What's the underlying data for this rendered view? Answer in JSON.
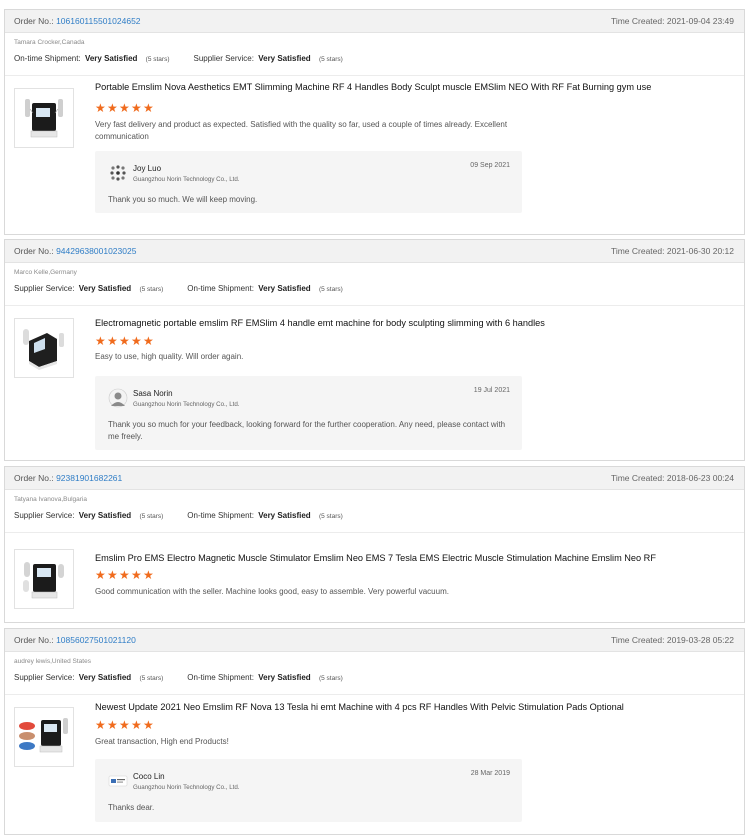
{
  "labels": {
    "order_no": "Order No.:",
    "time_created": "Time Created:",
    "ontime_shipment": "On-time Shipment:",
    "supplier_service": "Supplier Service:"
  },
  "reviews": [
    {
      "order_no": "10616011550102465 2",
      "order_no_display": "106160115501024652",
      "time_created": "2021-09-04 23:49",
      "buyer": "Tamara Crocker,Canada",
      "rating1_label": "On-time Shipment:",
      "rating1_value": "Very Satisfied",
      "rating1_stars": "(5 stars)",
      "rating2_label": "Supplier Service:",
      "rating2_value": "Very Satisfied",
      "rating2_stars": "(5 stars)",
      "product_title": "Portable Emslim Nova Aesthetics EMT Slimming Machine RF 4 Handles Body Sculpt muscle EMSlim NEO With RF Fat Burning gym use",
      "stars": 5,
      "review_text": "Very fast delivery and product as expected. Satisfied with the quality so far, used a couple of times already. Excellent communication",
      "reply_name": "Joy Luo",
      "reply_company": "Guangzhou Norin Technology Co., Ltd.",
      "reply_date": "09 Sep 2021",
      "reply_text": "Thank you so much. We will keep moving."
    },
    {
      "order_no_display": "94429638001023025",
      "time_created": "2021-06-30 20:12",
      "buyer": "Marco Kelle,Germany",
      "rating1_label": "Supplier Service:",
      "rating1_value": "Very Satisfied",
      "rating1_stars": "(5 stars)",
      "rating2_label": "On-time Shipment:",
      "rating2_value": "Very Satisfied",
      "rating2_stars": "(5 stars)",
      "product_title": "Electromagnetic portable emslim RF EMSlim 4 handle emt machine for body sculpting slimming with 6 handles",
      "stars": 5,
      "review_text": "Easy to use, high quality. Will order again.",
      "reply_name": "Sasa Norin",
      "reply_company": "Guangzhou Norin Technology Co., Ltd.",
      "reply_date": "19 Jul 2021",
      "reply_text": "Thank you so much for your feedback, looking forward for the further cooperation. Any need, please contact with me freely."
    },
    {
      "order_no_display": "92381901682261",
      "time_created": "2018-06-23 00:24",
      "buyer": "Tatyana Ivanova,Bulgaria",
      "rating1_label": "Supplier Service:",
      "rating1_value": "Very Satisfied",
      "rating1_stars": "(5 stars)",
      "rating2_label": "On-time Shipment:",
      "rating2_value": "Very Satisfied",
      "rating2_stars": "(5 stars)",
      "product_title": "Emslim Pro EMS Electro Magnetic Muscle Stimulator Emslim Neo EMS 7 Tesla EMS Electric Muscle Stimulation Machine Emslim Neo RF",
      "stars": 5,
      "review_text": "Good communication with the seller. Machine looks good, easy to assemble. Very powerful vacuum."
    },
    {
      "order_no_display": "10856027501021120",
      "time_created": "2019-03-28 05:22",
      "buyer": "audrey lewis,United States",
      "rating1_label": "Supplier Service:",
      "rating1_value": "Very Satisfied",
      "rating1_stars": "(5 stars)",
      "rating2_label": "On-time Shipment:",
      "rating2_value": "Very Satisfied",
      "rating2_stars": "(5 stars)",
      "product_title": "Newest Update 2021 Neo Emslim RF Nova 13 Tesla hi emt Machine with 4 pcs RF Handles With Pelvic Stimulation Pads Optional",
      "stars": 5,
      "review_text": "Great transaction, High end Products!",
      "reply_name": "Coco Lin",
      "reply_company": "Guangzhou Norin Technology Co., Ltd.",
      "reply_date": "28 Mar 2019",
      "reply_text": "Thanks dear."
    }
  ],
  "colors": {
    "link": "#2f7dc6",
    "star": "#f06b1d",
    "header_bg": "#f2f2f2",
    "reply_bg": "#f5f5f5"
  }
}
